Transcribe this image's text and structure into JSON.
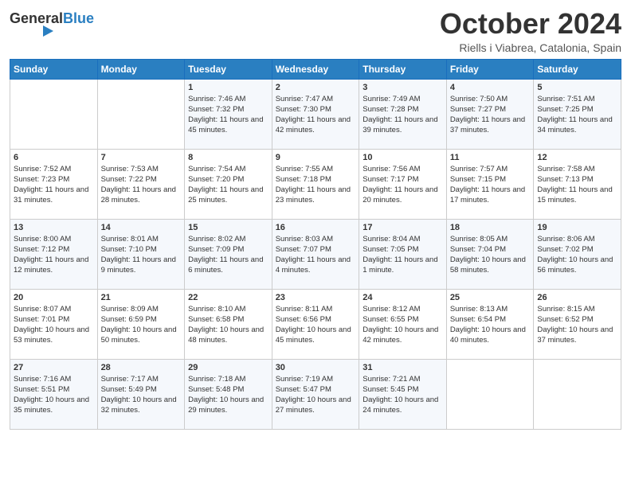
{
  "header": {
    "logo_general": "General",
    "logo_blue": "Blue",
    "month_title": "October 2024",
    "subtitle": "Riells i Viabrea, Catalonia, Spain"
  },
  "days_of_week": [
    "Sunday",
    "Monday",
    "Tuesday",
    "Wednesday",
    "Thursday",
    "Friday",
    "Saturday"
  ],
  "weeks": [
    [
      {
        "day": "",
        "sunrise": "",
        "sunset": "",
        "daylight": ""
      },
      {
        "day": "",
        "sunrise": "",
        "sunset": "",
        "daylight": ""
      },
      {
        "day": "1",
        "sunrise": "Sunrise: 7:46 AM",
        "sunset": "Sunset: 7:32 PM",
        "daylight": "Daylight: 11 hours and 45 minutes."
      },
      {
        "day": "2",
        "sunrise": "Sunrise: 7:47 AM",
        "sunset": "Sunset: 7:30 PM",
        "daylight": "Daylight: 11 hours and 42 minutes."
      },
      {
        "day": "3",
        "sunrise": "Sunrise: 7:49 AM",
        "sunset": "Sunset: 7:28 PM",
        "daylight": "Daylight: 11 hours and 39 minutes."
      },
      {
        "day": "4",
        "sunrise": "Sunrise: 7:50 AM",
        "sunset": "Sunset: 7:27 PM",
        "daylight": "Daylight: 11 hours and 37 minutes."
      },
      {
        "day": "5",
        "sunrise": "Sunrise: 7:51 AM",
        "sunset": "Sunset: 7:25 PM",
        "daylight": "Daylight: 11 hours and 34 minutes."
      }
    ],
    [
      {
        "day": "6",
        "sunrise": "Sunrise: 7:52 AM",
        "sunset": "Sunset: 7:23 PM",
        "daylight": "Daylight: 11 hours and 31 minutes."
      },
      {
        "day": "7",
        "sunrise": "Sunrise: 7:53 AM",
        "sunset": "Sunset: 7:22 PM",
        "daylight": "Daylight: 11 hours and 28 minutes."
      },
      {
        "day": "8",
        "sunrise": "Sunrise: 7:54 AM",
        "sunset": "Sunset: 7:20 PM",
        "daylight": "Daylight: 11 hours and 25 minutes."
      },
      {
        "day": "9",
        "sunrise": "Sunrise: 7:55 AM",
        "sunset": "Sunset: 7:18 PM",
        "daylight": "Daylight: 11 hours and 23 minutes."
      },
      {
        "day": "10",
        "sunrise": "Sunrise: 7:56 AM",
        "sunset": "Sunset: 7:17 PM",
        "daylight": "Daylight: 11 hours and 20 minutes."
      },
      {
        "day": "11",
        "sunrise": "Sunrise: 7:57 AM",
        "sunset": "Sunset: 7:15 PM",
        "daylight": "Daylight: 11 hours and 17 minutes."
      },
      {
        "day": "12",
        "sunrise": "Sunrise: 7:58 AM",
        "sunset": "Sunset: 7:13 PM",
        "daylight": "Daylight: 11 hours and 15 minutes."
      }
    ],
    [
      {
        "day": "13",
        "sunrise": "Sunrise: 8:00 AM",
        "sunset": "Sunset: 7:12 PM",
        "daylight": "Daylight: 11 hours and 12 minutes."
      },
      {
        "day": "14",
        "sunrise": "Sunrise: 8:01 AM",
        "sunset": "Sunset: 7:10 PM",
        "daylight": "Daylight: 11 hours and 9 minutes."
      },
      {
        "day": "15",
        "sunrise": "Sunrise: 8:02 AM",
        "sunset": "Sunset: 7:09 PM",
        "daylight": "Daylight: 11 hours and 6 minutes."
      },
      {
        "day": "16",
        "sunrise": "Sunrise: 8:03 AM",
        "sunset": "Sunset: 7:07 PM",
        "daylight": "Daylight: 11 hours and 4 minutes."
      },
      {
        "day": "17",
        "sunrise": "Sunrise: 8:04 AM",
        "sunset": "Sunset: 7:05 PM",
        "daylight": "Daylight: 11 hours and 1 minute."
      },
      {
        "day": "18",
        "sunrise": "Sunrise: 8:05 AM",
        "sunset": "Sunset: 7:04 PM",
        "daylight": "Daylight: 10 hours and 58 minutes."
      },
      {
        "day": "19",
        "sunrise": "Sunrise: 8:06 AM",
        "sunset": "Sunset: 7:02 PM",
        "daylight": "Daylight: 10 hours and 56 minutes."
      }
    ],
    [
      {
        "day": "20",
        "sunrise": "Sunrise: 8:07 AM",
        "sunset": "Sunset: 7:01 PM",
        "daylight": "Daylight: 10 hours and 53 minutes."
      },
      {
        "day": "21",
        "sunrise": "Sunrise: 8:09 AM",
        "sunset": "Sunset: 6:59 PM",
        "daylight": "Daylight: 10 hours and 50 minutes."
      },
      {
        "day": "22",
        "sunrise": "Sunrise: 8:10 AM",
        "sunset": "Sunset: 6:58 PM",
        "daylight": "Daylight: 10 hours and 48 minutes."
      },
      {
        "day": "23",
        "sunrise": "Sunrise: 8:11 AM",
        "sunset": "Sunset: 6:56 PM",
        "daylight": "Daylight: 10 hours and 45 minutes."
      },
      {
        "day": "24",
        "sunrise": "Sunrise: 8:12 AM",
        "sunset": "Sunset: 6:55 PM",
        "daylight": "Daylight: 10 hours and 42 minutes."
      },
      {
        "day": "25",
        "sunrise": "Sunrise: 8:13 AM",
        "sunset": "Sunset: 6:54 PM",
        "daylight": "Daylight: 10 hours and 40 minutes."
      },
      {
        "day": "26",
        "sunrise": "Sunrise: 8:15 AM",
        "sunset": "Sunset: 6:52 PM",
        "daylight": "Daylight: 10 hours and 37 minutes."
      }
    ],
    [
      {
        "day": "27",
        "sunrise": "Sunrise: 7:16 AM",
        "sunset": "Sunset: 5:51 PM",
        "daylight": "Daylight: 10 hours and 35 minutes."
      },
      {
        "day": "28",
        "sunrise": "Sunrise: 7:17 AM",
        "sunset": "Sunset: 5:49 PM",
        "daylight": "Daylight: 10 hours and 32 minutes."
      },
      {
        "day": "29",
        "sunrise": "Sunrise: 7:18 AM",
        "sunset": "Sunset: 5:48 PM",
        "daylight": "Daylight: 10 hours and 29 minutes."
      },
      {
        "day": "30",
        "sunrise": "Sunrise: 7:19 AM",
        "sunset": "Sunset: 5:47 PM",
        "daylight": "Daylight: 10 hours and 27 minutes."
      },
      {
        "day": "31",
        "sunrise": "Sunrise: 7:21 AM",
        "sunset": "Sunset: 5:45 PM",
        "daylight": "Daylight: 10 hours and 24 minutes."
      },
      {
        "day": "",
        "sunrise": "",
        "sunset": "",
        "daylight": ""
      },
      {
        "day": "",
        "sunrise": "",
        "sunset": "",
        "daylight": ""
      }
    ]
  ]
}
